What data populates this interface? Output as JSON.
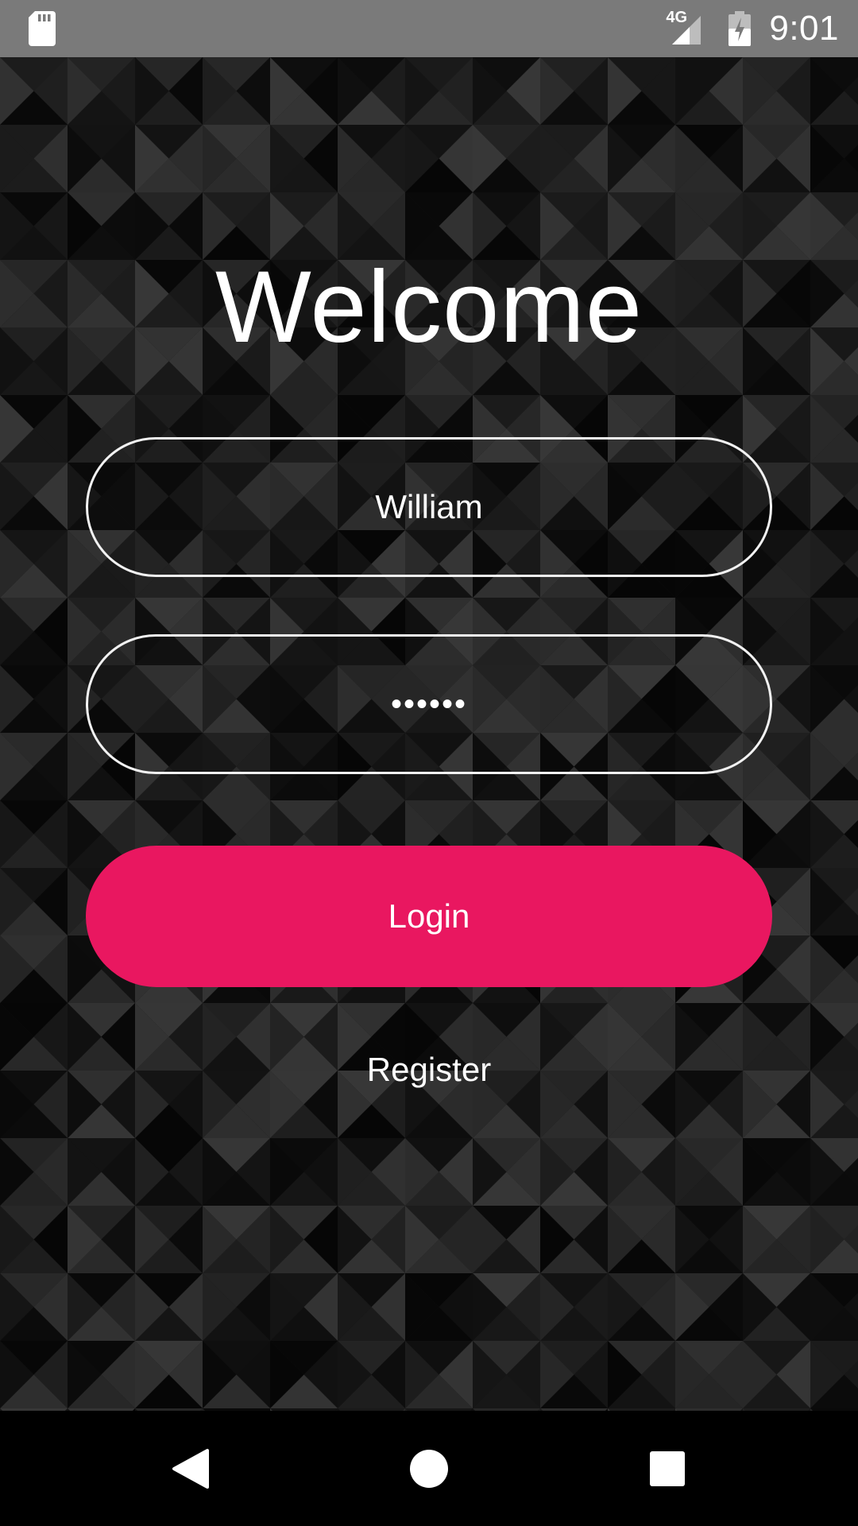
{
  "status_bar": {
    "network_type": "4G",
    "time": "9:01",
    "icons": [
      "sd-card-icon",
      "cell-signal-icon",
      "battery-charging-icon"
    ]
  },
  "login": {
    "title": "Welcome",
    "username_value": "William",
    "password_masked": "••••••",
    "login_label": "Login",
    "register_label": "Register"
  },
  "nav_bar": {
    "icons": [
      "back-icon",
      "home-icon",
      "recents-icon"
    ]
  },
  "colors": {
    "accent": "#e91760",
    "status_bar": "#7a7a7a",
    "background": "#141414",
    "field_border": "#f2f2f2",
    "text": "#ffffff"
  }
}
